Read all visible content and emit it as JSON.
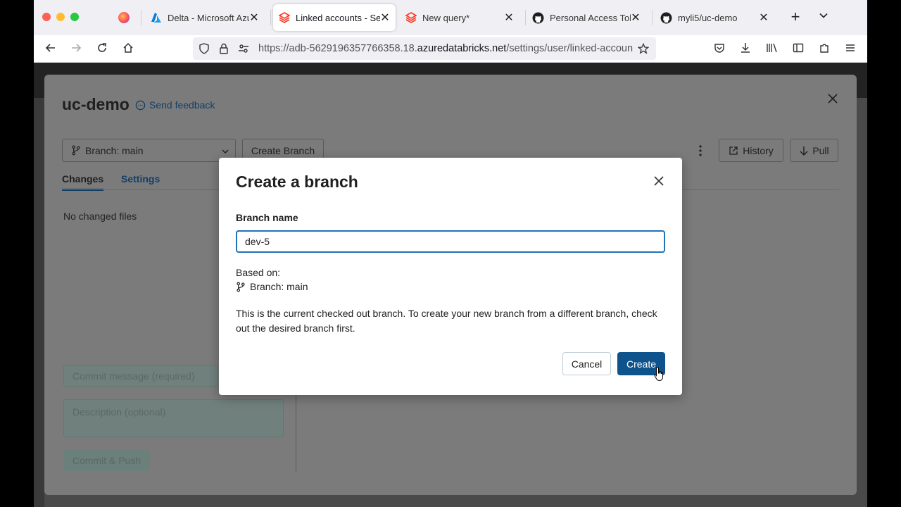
{
  "tabs": [
    {
      "title": "Delta - Microsoft Azure",
      "icon": "azure-icon"
    },
    {
      "title": "Linked accounts - Settings",
      "icon": "databricks-icon",
      "active": true
    },
    {
      "title": "New query*",
      "icon": "databricks-icon"
    },
    {
      "title": "Personal Access Tokens",
      "icon": "github-icon"
    },
    {
      "title": "myli5/uc-demo",
      "icon": "github-icon"
    }
  ],
  "url": {
    "prefix": "https://adb-5629196357766358.18.",
    "domain": "azuredatabricks.net",
    "path": "/settings/user/linked-accounts"
  },
  "panel": {
    "title": "uc-demo",
    "feedback": "Send feedback",
    "branch_select": "Branch: main",
    "create_branch": "Create Branch",
    "history": "History",
    "pull": "Pull",
    "tabs": [
      "Changes",
      "Settings"
    ],
    "no_changes": "No changed files",
    "commit_placeholder": "Commit message (required)",
    "description_placeholder": "Description (optional)",
    "commit_push": "Commit & Push"
  },
  "modal": {
    "title": "Create a branch",
    "branch_name_label": "Branch name",
    "branch_name_value": "dev-5",
    "based_on_label": "Based on:",
    "based_on_branch": "Branch: main",
    "description": "This is the current checked out branch. To create your new branch from a different branch, check out the desired branch first.",
    "cancel_label": "Cancel",
    "create_label": "Create"
  },
  "colors": {
    "primary": "#0e538b",
    "focus": "#2272b4",
    "link": "#5fa8e0"
  }
}
